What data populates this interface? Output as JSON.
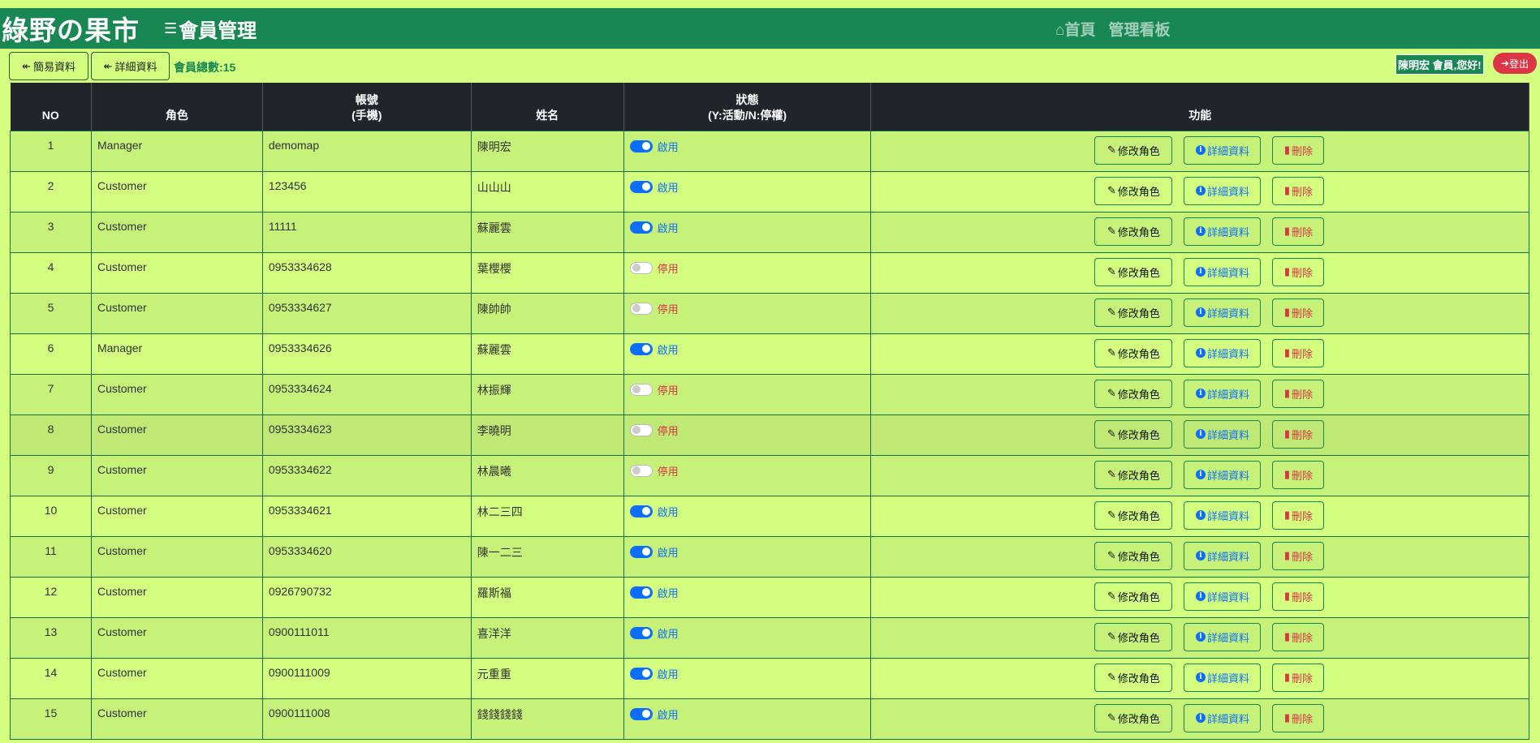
{
  "brand": "綠野の果市",
  "page_title": "會員管理",
  "nav": {
    "home": "首頁",
    "dashboard": "管理看板"
  },
  "toolbar": {
    "simple_btn": "簡易資料",
    "detail_btn": "詳細資料",
    "count_label": "會員總數:15"
  },
  "user": {
    "greeting": "陳明宏 會員,您好!",
    "logout": "登出"
  },
  "table": {
    "headers": {
      "no": "NO",
      "role": "角色",
      "account_line1": "帳號",
      "account_line2": "(手機)",
      "name": "姓名",
      "status_line1": "狀態",
      "status_line2": "(Y:活動/N:停權)",
      "actions": "功能"
    },
    "action_labels": {
      "edit_role": "修改角色",
      "details": "詳細資料",
      "delete": "刪除"
    },
    "status_labels": {
      "on": "啟用",
      "off": "停用"
    },
    "rows": [
      {
        "no": "1",
        "role": "Manager",
        "account": "demomap",
        "name": "陳明宏",
        "active": true
      },
      {
        "no": "2",
        "role": "Customer",
        "account": "123456",
        "name": "山山山",
        "active": true
      },
      {
        "no": "3",
        "role": "Customer",
        "account": "11111",
        "name": "蘇麗雲",
        "active": true
      },
      {
        "no": "4",
        "role": "Customer",
        "account": "0953334628",
        "name": "葉櫻櫻",
        "active": false
      },
      {
        "no": "5",
        "role": "Customer",
        "account": "0953334627",
        "name": "陳帥帥",
        "active": false
      },
      {
        "no": "6",
        "role": "Manager",
        "account": "0953334626",
        "name": "蘇麗雲",
        "active": true
      },
      {
        "no": "7",
        "role": "Customer",
        "account": "0953334624",
        "name": "林振輝",
        "active": false
      },
      {
        "no": "8",
        "role": "Customer",
        "account": "0953334623",
        "name": "李曉明",
        "active": false
      },
      {
        "no": "9",
        "role": "Customer",
        "account": "0953334622",
        "name": "林晨曦",
        "active": false
      },
      {
        "no": "10",
        "role": "Customer",
        "account": "0953334621",
        "name": "林二三四",
        "active": true
      },
      {
        "no": "11",
        "role": "Customer",
        "account": "0953334620",
        "name": "陳一二三",
        "active": true
      },
      {
        "no": "12",
        "role": "Customer",
        "account": "0926790732",
        "name": "羅斯福",
        "active": true
      },
      {
        "no": "13",
        "role": "Customer",
        "account": "0900111011",
        "name": "喜洋洋",
        "active": true
      },
      {
        "no": "14",
        "role": "Customer",
        "account": "0900111009",
        "name": "元重重",
        "active": true
      },
      {
        "no": "15",
        "role": "Customer",
        "account": "0900111008",
        "name": "錢錢錢錢",
        "active": true
      }
    ]
  },
  "colors": {
    "page_bg": "#d3fe7f",
    "navbar": "#198754",
    "table_header": "#212529",
    "switch_on": "#0d6efd",
    "danger": "#dc3545"
  }
}
